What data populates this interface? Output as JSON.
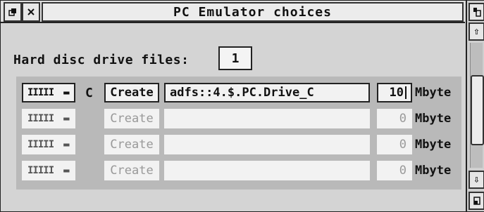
{
  "window": {
    "title": "PC Emulator choices",
    "back_icon": "back-icon",
    "close_icon": "close-icon"
  },
  "scrollbar": {
    "toggle_icon": "toggle-size-icon",
    "up_arrow": "⇧",
    "down_arrow": "⇩",
    "resize_icon": "resize-icon"
  },
  "hard_disc": {
    "label": "Hard disc drive files:",
    "count": "1"
  },
  "drives": [
    {
      "menu_glyph": "IIIII",
      "menu_arrow": "▬",
      "letter": "C",
      "create_label": "Create",
      "path": "adfs::4.$.PC.Drive_C",
      "size": "10",
      "unit": "Mbyte",
      "enabled": true
    },
    {
      "menu_glyph": "IIIII",
      "menu_arrow": "▬",
      "letter": "",
      "create_label": "Create",
      "path": "",
      "size": "0",
      "unit": "Mbyte",
      "enabled": false
    },
    {
      "menu_glyph": "IIIII",
      "menu_arrow": "▬",
      "letter": "",
      "create_label": "Create",
      "path": "",
      "size": "0",
      "unit": "Mbyte",
      "enabled": false
    },
    {
      "menu_glyph": "IIIII",
      "menu_arrow": "▬",
      "letter": "",
      "create_label": "Create",
      "path": "",
      "size": "0",
      "unit": "Mbyte",
      "enabled": false
    }
  ]
}
